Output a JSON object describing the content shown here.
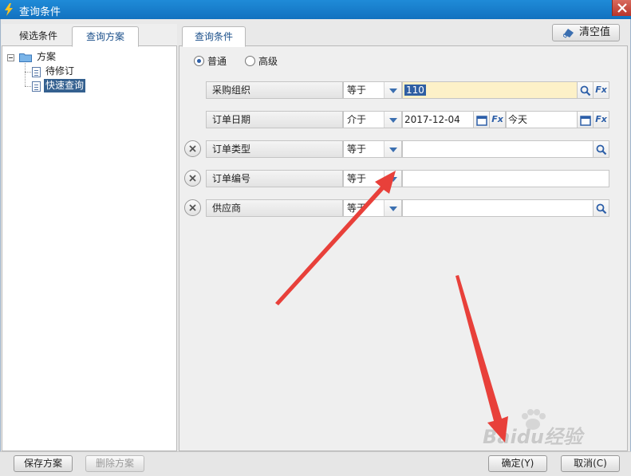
{
  "window": {
    "title": "查询条件"
  },
  "left_panel": {
    "tabs": [
      {
        "label": "候选条件"
      },
      {
        "label": "查询方案"
      }
    ],
    "tree": {
      "root": "方案",
      "children": [
        {
          "label": "待修订"
        },
        {
          "label": "快速查询",
          "selected": true
        }
      ]
    }
  },
  "right_panel": {
    "tab": "查询条件",
    "clear_button": "清空值",
    "modes": [
      {
        "label": "普通",
        "checked": true
      },
      {
        "label": "高级",
        "checked": false
      }
    ],
    "conditions": [
      {
        "field": "采购组织",
        "operator": "等于",
        "value": "110",
        "removable": false
      },
      {
        "field": "订单日期",
        "operator": "介于",
        "value": "2017-12-04",
        "value2": "今天",
        "removable": false
      },
      {
        "field": "订单类型",
        "operator": "等于",
        "value": "",
        "removable": true
      },
      {
        "field": "订单编号",
        "operator": "等于",
        "value": "",
        "removable": true
      },
      {
        "field": "供应商",
        "operator": "等于",
        "value": "",
        "removable": true
      }
    ],
    "fx_label": "Fx"
  },
  "footer": {
    "save_plan": "保存方案",
    "delete_plan": "删除方案",
    "ok": "确定(Y)",
    "cancel": "取消(C)"
  },
  "watermark": "Baidu经验",
  "colors": {
    "titlebar": "#1a7ecb",
    "accent": "#2f5fa3",
    "highlight_field": "#fdf1c8",
    "arrow": "#e8403a"
  }
}
